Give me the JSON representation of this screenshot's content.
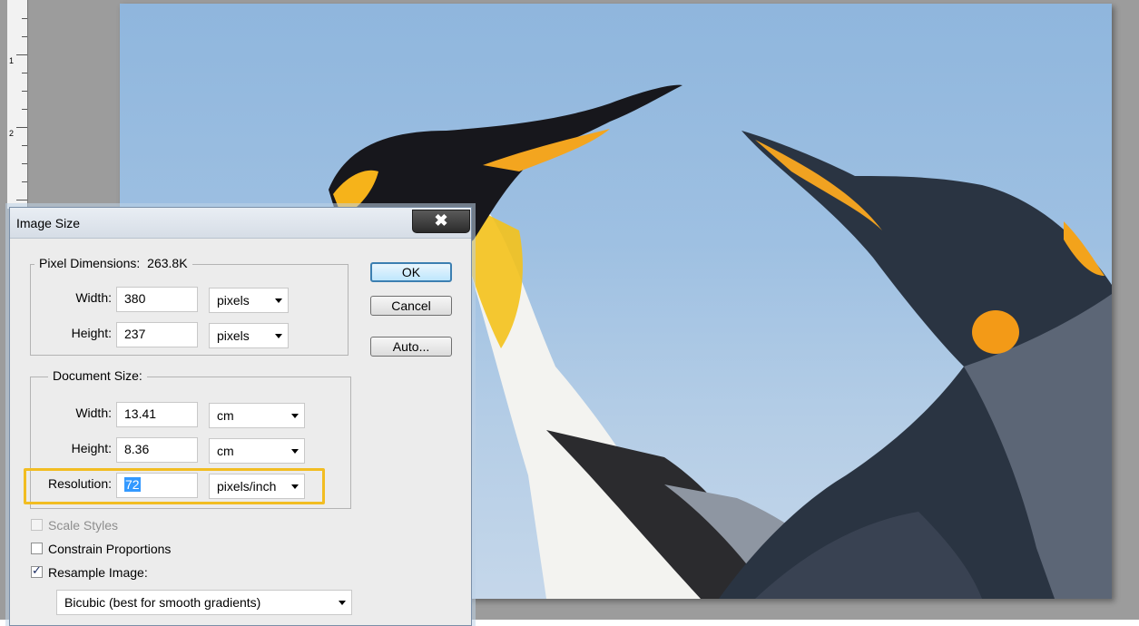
{
  "dialog": {
    "title": "Image Size",
    "close_glyph": "✖"
  },
  "pixel_dimensions": {
    "label": "Pixel Dimensions:",
    "size": "263.8K",
    "width_label": "Width:",
    "width_value": "380",
    "width_unit": "pixels",
    "height_label": "Height:",
    "height_value": "237",
    "height_unit": "pixels"
  },
  "document_size": {
    "label": "Document Size:",
    "width_label": "Width:",
    "width_value": "13.41",
    "width_unit": "cm",
    "height_label": "Height:",
    "height_value": "8.36",
    "height_unit": "cm",
    "resolution_label": "Resolution:",
    "resolution_value": "72",
    "resolution_unit": "pixels/inch"
  },
  "buttons": {
    "ok": "OK",
    "cancel": "Cancel",
    "auto": "Auto..."
  },
  "options": {
    "scale_styles": "Scale Styles",
    "scale_styles_checked": false,
    "scale_styles_enabled": false,
    "constrain_proportions": "Constrain Proportions",
    "constrain_checked": false,
    "resample_image": "Resample Image:",
    "resample_checked": true,
    "resample_method": "Bicubic (best for smooth gradients)"
  },
  "ruler": {
    "marks": [
      "1",
      "2"
    ]
  },
  "colors": {
    "highlight": "#f2bd22",
    "sky": "#9ec0e2",
    "selection": "#3399ff"
  }
}
